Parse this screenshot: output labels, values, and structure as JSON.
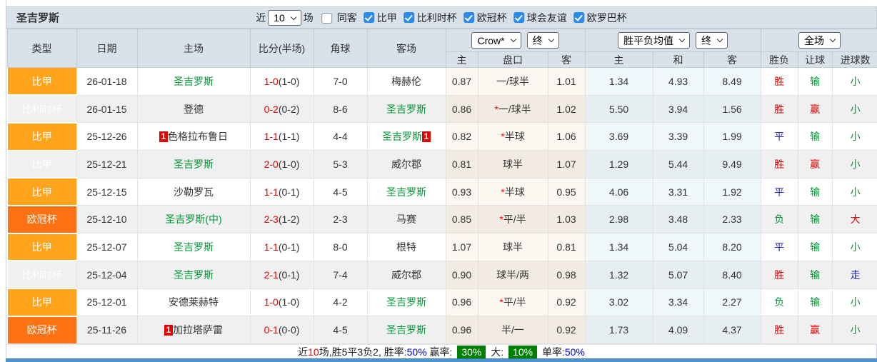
{
  "title": "圣吉罗斯",
  "controls": {
    "near_label": "近",
    "match_count": "10",
    "games_label": "场",
    "same_away_label": "同客",
    "leagues": [
      "比甲",
      "比利时杯",
      "欧冠杯",
      "球会友谊",
      "欧罗巴杯"
    ]
  },
  "table": {
    "main_headers": [
      "类型",
      "日期",
      "主场",
      "比分(半场)",
      "角球",
      "客场"
    ],
    "odds_selects": {
      "bookmaker": "Crow*",
      "bookmaker_final": "终",
      "avg": "胜平负均值",
      "avg_final": "终",
      "full": "全场"
    },
    "sub_headers": [
      "主",
      "盘口",
      "客",
      "主",
      "和",
      "客",
      "胜负",
      "让球",
      "进球数"
    ],
    "rows": [
      {
        "league": "比甲",
        "cl": false,
        "date": "26-01-18",
        "home": "圣吉罗斯",
        "home_green": true,
        "home_card": false,
        "score": "1-0",
        "half": "(1-0)",
        "corners": "7-0",
        "away": "梅赫伦",
        "away_green": false,
        "away_card": false,
        "crow_home": "0.87",
        "line": "一/球半",
        "line_star": false,
        "crow_away": "1.01",
        "avg_home": "1.34",
        "avg_draw": "4.93",
        "avg_away": "8.49",
        "result": "胜",
        "result_color": "r",
        "handicap": "输",
        "handicap_color": "g",
        "goals": "小",
        "goals_color": "g"
      },
      {
        "league": "比利时杯",
        "cl": false,
        "date": "26-01-15",
        "home": "登德",
        "home_green": false,
        "home_card": false,
        "score": "0-2",
        "half": "(0-2)",
        "corners": "8-6",
        "away": "圣吉罗斯",
        "away_green": true,
        "away_card": false,
        "crow_home": "0.86",
        "line": "一/球半",
        "line_star": true,
        "crow_away": "1.02",
        "avg_home": "5.50",
        "avg_draw": "3.94",
        "avg_away": "1.56",
        "result": "胜",
        "result_color": "r",
        "handicap": "赢",
        "handicap_color": "r",
        "goals": "小",
        "goals_color": "g"
      },
      {
        "league": "比甲",
        "cl": false,
        "date": "25-12-26",
        "home": "色格拉布鲁日",
        "home_green": false,
        "home_card": true,
        "score": "1-1",
        "half": "(1-1)",
        "corners": "4-4",
        "away": "圣吉罗斯",
        "away_green": true,
        "away_card": true,
        "crow_home": "0.82",
        "line": "半球",
        "line_star": true,
        "crow_away": "1.06",
        "avg_home": "3.69",
        "avg_draw": "3.39",
        "avg_away": "1.99",
        "result": "平",
        "result_color": "b",
        "handicap": "输",
        "handicap_color": "g",
        "goals": "小",
        "goals_color": "g"
      },
      {
        "league": "比甲",
        "cl": false,
        "date": "25-12-21",
        "home": "圣吉罗斯",
        "home_green": true,
        "home_card": false,
        "score": "2-0",
        "half": "(1-0)",
        "corners": "5-3",
        "away": "威尔郡",
        "away_green": false,
        "away_card": false,
        "crow_home": "0.81",
        "line": "球半",
        "line_star": false,
        "crow_away": "1.07",
        "avg_home": "1.29",
        "avg_draw": "5.44",
        "avg_away": "9.49",
        "result": "胜",
        "result_color": "r",
        "handicap": "赢",
        "handicap_color": "r",
        "goals": "小",
        "goals_color": "g"
      },
      {
        "league": "比甲",
        "cl": false,
        "date": "25-12-15",
        "home": "沙勒罗瓦",
        "home_green": false,
        "home_card": false,
        "score": "1-1",
        "half": "(0-1)",
        "corners": "4-5",
        "away": "圣吉罗斯",
        "away_green": true,
        "away_card": false,
        "crow_home": "0.93",
        "line": "半球",
        "line_star": true,
        "crow_away": "0.95",
        "avg_home": "4.06",
        "avg_draw": "3.31",
        "avg_away": "1.92",
        "result": "平",
        "result_color": "b",
        "handicap": "输",
        "handicap_color": "g",
        "goals": "小",
        "goals_color": "g"
      },
      {
        "league": "欧冠杯",
        "cl": true,
        "date": "25-12-10",
        "home": "圣吉罗斯(中)",
        "home_green": true,
        "home_card": false,
        "score": "2-3",
        "half": "(1-2)",
        "corners": "2-3",
        "away": "马赛",
        "away_green": false,
        "away_card": false,
        "crow_home": "0.85",
        "line": "平/半",
        "line_star": true,
        "crow_away": "1.03",
        "avg_home": "2.98",
        "avg_draw": "3.48",
        "avg_away": "2.33",
        "result": "负",
        "result_color": "g",
        "handicap": "输",
        "handicap_color": "g",
        "goals": "大",
        "goals_color": "r"
      },
      {
        "league": "比甲",
        "cl": false,
        "date": "25-12-07",
        "home": "圣吉罗斯",
        "home_green": true,
        "home_card": false,
        "score": "1-1",
        "half": "(0-1)",
        "corners": "8-0",
        "away": "根特",
        "away_green": false,
        "away_card": false,
        "crow_home": "1.07",
        "line": "球半",
        "line_star": false,
        "crow_away": "0.81",
        "avg_home": "1.34",
        "avg_draw": "5.04",
        "avg_away": "8.20",
        "result": "平",
        "result_color": "b",
        "handicap": "输",
        "handicap_color": "g",
        "goals": "小",
        "goals_color": "g"
      },
      {
        "league": "比利时杯",
        "cl": false,
        "date": "25-12-04",
        "home": "圣吉罗斯",
        "home_green": true,
        "home_card": false,
        "score": "2-1",
        "half": "(0-1)",
        "corners": "7-4",
        "away": "威尔郡",
        "away_green": false,
        "away_card": false,
        "crow_home": "0.90",
        "line": "球半/两",
        "line_star": false,
        "crow_away": "0.98",
        "avg_home": "1.32",
        "avg_draw": "5.07",
        "avg_away": "8.40",
        "result": "胜",
        "result_color": "r",
        "handicap": "输",
        "handicap_color": "g",
        "goals": "走",
        "goals_color": "b"
      },
      {
        "league": "比甲",
        "cl": false,
        "date": "25-12-01",
        "home": "安德莱赫特",
        "home_green": false,
        "home_card": false,
        "score": "1-0",
        "half": "(1-0)",
        "corners": "4-2",
        "away": "圣吉罗斯",
        "away_green": true,
        "away_card": false,
        "crow_home": "0.96",
        "line": "平/半",
        "line_star": true,
        "crow_away": "0.92",
        "avg_home": "3.02",
        "avg_draw": "3.34",
        "avg_away": "2.27",
        "result": "负",
        "result_color": "g",
        "handicap": "输",
        "handicap_color": "g",
        "goals": "小",
        "goals_color": "g"
      },
      {
        "league": "欧冠杯",
        "cl": true,
        "date": "25-11-26",
        "home": "加拉塔萨雷",
        "home_green": false,
        "home_card": true,
        "score": "0-1",
        "half": "(0-0)",
        "corners": "4-5",
        "away": "圣吉罗斯",
        "away_green": true,
        "away_card": false,
        "crow_home": "0.96",
        "line": "半/一",
        "line_star": false,
        "crow_away": "0.92",
        "avg_home": "1.73",
        "avg_draw": "4.09",
        "avg_away": "4.37",
        "result": "胜",
        "result_color": "r",
        "handicap": "赢",
        "handicap_color": "r",
        "goals": "小",
        "goals_color": "g"
      }
    ]
  },
  "footer": {
    "segments": [
      {
        "text": "近",
        "color": "k"
      },
      {
        "text": "10",
        "color": "r"
      },
      {
        "text": "场,胜5平3负2, 胜率:",
        "color": "k"
      },
      {
        "text": "50%",
        "color": "b"
      },
      {
        "text": " 赢率: ",
        "color": "k"
      },
      {
        "text": "30%",
        "color": "badge"
      },
      {
        "text": " 大: ",
        "color": "k"
      },
      {
        "text": "10%",
        "color": "badge"
      },
      {
        "text": " 单率:",
        "color": "k"
      },
      {
        "text": "50%",
        "color": "b"
      }
    ]
  },
  "red_card_badge": "1",
  "colors": {
    "league_orange": "#ffa41b",
    "cup_orange": "#ff7214",
    "win_red": "#e60000",
    "team_green": "#009933",
    "draw_blue": "#2323cc",
    "rate_badge_green": "#008000",
    "rate_link_blue": "#0000ee",
    "header_bg": "#d9e1eb",
    "bottom_bar_blue": "#4e93c9"
  }
}
